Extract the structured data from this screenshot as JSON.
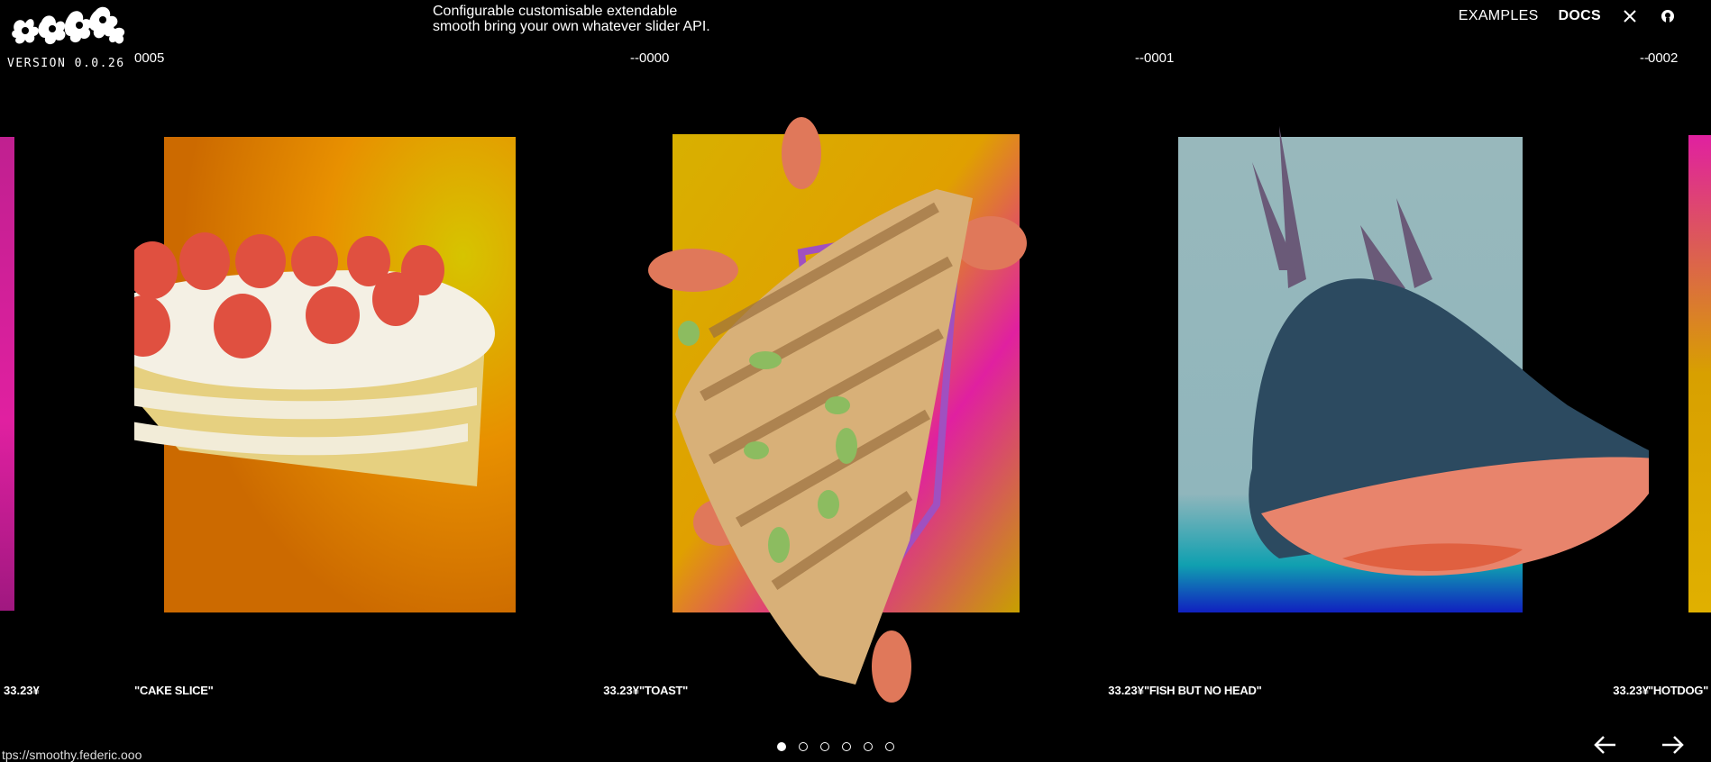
{
  "header": {
    "logo_text": "smoothy",
    "version": "VERSION  0.0.26",
    "tagline_line1": "Configurable customisable extendable",
    "tagline_line2": "smooth bring your own whatever slider API.",
    "nav": {
      "examples": "EXAMPLES",
      "docs": "DOCS",
      "x_icon": "x-icon",
      "github_icon": "github-icon"
    }
  },
  "edge": {
    "left_price": "33.23¥",
    "right_num": "0002",
    "right_title": "\"HOTDOG\""
  },
  "slides": [
    {
      "num": "0005",
      "dash": "--",
      "title": "\"CAKE SLICE\"",
      "price": "33.23¥",
      "bg": "#e07a08"
    },
    {
      "num": "0000",
      "dash": "--",
      "title": "\"TOAST\"",
      "price": "33.23¥",
      "bg": "#d4a800"
    },
    {
      "num": "0001",
      "dash": "--",
      "title": "\"FISH BUT NO HEAD\"",
      "price": "33.23¥",
      "bg": "#9fbfc4"
    }
  ],
  "pagination": {
    "count": 6,
    "active": 0
  },
  "controls": {
    "prev_icon": "arrow-left-icon",
    "next_icon": "arrow-right-icon"
  },
  "status_url": "tps://smoothy.federic.ooo"
}
